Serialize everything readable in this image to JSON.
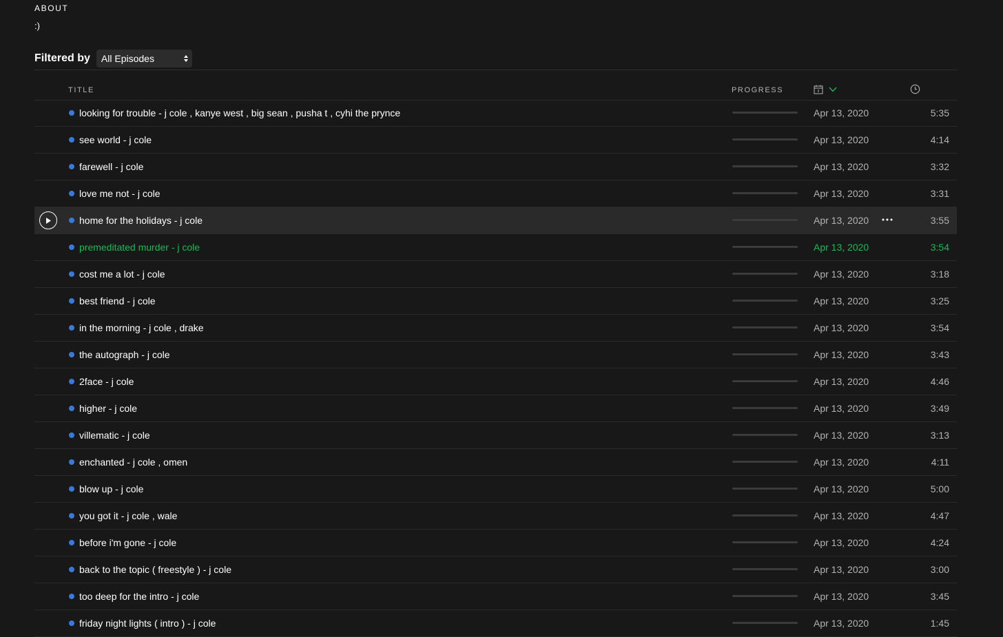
{
  "about": {
    "heading": "ABOUT",
    "text": ":)"
  },
  "filter": {
    "label": "Filtered by",
    "selected": "All Episodes"
  },
  "table": {
    "columns": {
      "title": "TITLE",
      "progress": "PROGRESS",
      "date_icon": "calendar-icon",
      "sort_icon": "chevron-down-icon",
      "duration_icon": "clock-icon"
    },
    "hovered_index": 4,
    "playing_index": 5,
    "colors": {
      "accent": "#1db954",
      "unplayed_dot": "#3a79d9",
      "background": "#181818",
      "row_hover": "#2a2a2a"
    },
    "episodes": [
      {
        "title": "looking for trouble - j cole , kanye west , big sean , pusha t , cyhi the prynce",
        "date": "Apr 13, 2020",
        "duration": "5:35",
        "progress": 0
      },
      {
        "title": "see world - j cole",
        "date": "Apr 13, 2020",
        "duration": "4:14",
        "progress": 0
      },
      {
        "title": "farewell - j cole",
        "date": "Apr 13, 2020",
        "duration": "3:32",
        "progress": 0
      },
      {
        "title": "love me not - j cole",
        "date": "Apr 13, 2020",
        "duration": "3:31",
        "progress": 0
      },
      {
        "title": "home for the holidays - j cole",
        "date": "Apr 13, 2020",
        "duration": "3:55",
        "progress": 0
      },
      {
        "title": "premeditated murder - j cole",
        "date": "Apr 13, 2020",
        "duration": "3:54",
        "progress": 0
      },
      {
        "title": "cost me a lot - j cole",
        "date": "Apr 13, 2020",
        "duration": "3:18",
        "progress": 0
      },
      {
        "title": "best friend - j cole",
        "date": "Apr 13, 2020",
        "duration": "3:25",
        "progress": 0
      },
      {
        "title": "in the morning - j cole , drake",
        "date": "Apr 13, 2020",
        "duration": "3:54",
        "progress": 0
      },
      {
        "title": "the autograph - j cole",
        "date": "Apr 13, 2020",
        "duration": "3:43",
        "progress": 0
      },
      {
        "title": "2face - j cole",
        "date": "Apr 13, 2020",
        "duration": "4:46",
        "progress": 0
      },
      {
        "title": "higher - j cole",
        "date": "Apr 13, 2020",
        "duration": "3:49",
        "progress": 0
      },
      {
        "title": "villematic - j cole",
        "date": "Apr 13, 2020",
        "duration": "3:13",
        "progress": 0
      },
      {
        "title": "enchanted - j cole , omen",
        "date": "Apr 13, 2020",
        "duration": "4:11",
        "progress": 0
      },
      {
        "title": "blow up - j cole",
        "date": "Apr 13, 2020",
        "duration": "5:00",
        "progress": 0
      },
      {
        "title": "you got it - j cole , wale",
        "date": "Apr 13, 2020",
        "duration": "4:47",
        "progress": 0
      },
      {
        "title": "before i'm gone - j cole",
        "date": "Apr 13, 2020",
        "duration": "4:24",
        "progress": 0
      },
      {
        "title": "back to the topic ( freestyle ) - j cole",
        "date": "Apr 13, 2020",
        "duration": "3:00",
        "progress": 0
      },
      {
        "title": "too deep for the intro - j cole",
        "date": "Apr 13, 2020",
        "duration": "3:45",
        "progress": 0
      },
      {
        "title": "friday night lights ( intro ) - j cole",
        "date": "Apr 13, 2020",
        "duration": "1:45",
        "progress": 0
      }
    ]
  }
}
